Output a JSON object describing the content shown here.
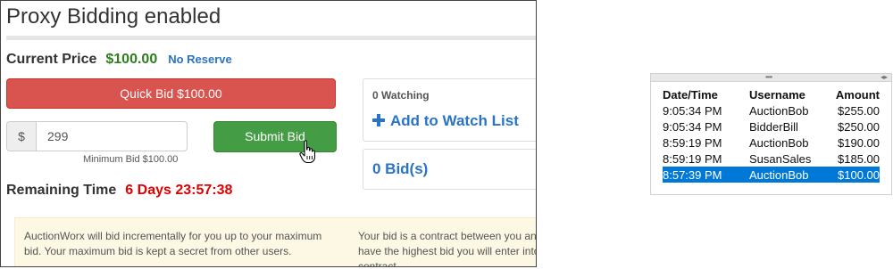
{
  "bidding": {
    "title": "Proxy Bidding enabled",
    "current_price_label": "Current Price",
    "current_price_value": "$100.00",
    "reserve_text": "No Reserve",
    "quick_bid_label": "Quick Bid $100.00",
    "currency_symbol": "$",
    "bid_amount_value": "299",
    "minimum_bid_text": "Minimum Bid $100.00",
    "submit_bid_label": "Submit Bid",
    "remaining_time_label": "Remaining Time",
    "remaining_time_value": "6 Days 23:57:38",
    "watching_text": "0 Watching",
    "add_watch_label": "Add to Watch List",
    "bids_count_label": "0 Bid(s)",
    "info_left_text": "AuctionWorx will bid incrementally for you up to your maximum bid. Your maximum bid is kept a secret from other users.",
    "info_right_line1": "Your bid is a contract between you and",
    "info_right_line2": "have the highest bid you will enter into",
    "info_right_line3": "contract."
  },
  "bid_history": {
    "columns": [
      "Date/Time",
      "Username",
      "Amount"
    ],
    "rows": [
      {
        "time": "9:05:34 PM",
        "user": "AuctionBob",
        "amount": "$255.00",
        "selected": false
      },
      {
        "time": "9:05:34 PM",
        "user": "BidderBill",
        "amount": "$250.00",
        "selected": false
      },
      {
        "time": "8:59:19 PM",
        "user": "AuctionBob",
        "amount": "$190.00",
        "selected": false
      },
      {
        "time": "8:59:19 PM",
        "user": "SusanSales",
        "amount": "$185.00",
        "selected": false
      },
      {
        "time": "8:57:39 PM",
        "user": "AuctionBob",
        "amount": "$100.00",
        "selected": true
      }
    ]
  },
  "colors": {
    "price_green": "#2e7d1e",
    "quick_bid_red": "#d9534f",
    "submit_green": "#449d44",
    "time_red": "#e00000",
    "link_blue": "#2a74c4",
    "selection_blue": "#0078d7"
  }
}
